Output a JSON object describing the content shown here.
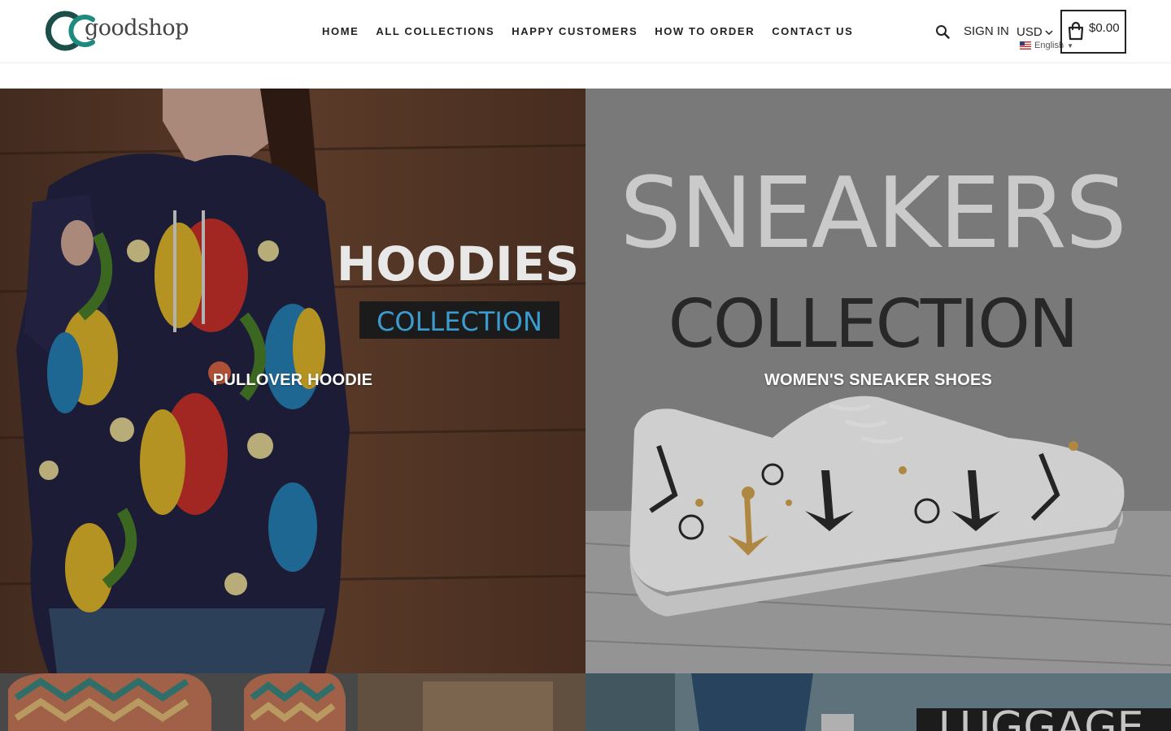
{
  "header": {
    "logo_text": "goodshop",
    "nav": [
      {
        "label": "HOME"
      },
      {
        "label": "ALL COLLECTIONS"
      },
      {
        "label": "HAPPY CUSTOMERS"
      },
      {
        "label": "HOW TO ORDER"
      },
      {
        "label": "CONTACT US"
      }
    ],
    "sign_in": "SIGN IN",
    "currency": "USD",
    "language": "English",
    "cart_total": "$0.00"
  },
  "collections": [
    {
      "title": "PULLOVER HOODIE",
      "banner_heading": "HOODIES",
      "banner_sub": "COLLECTION"
    },
    {
      "title": "WOMEN'S SNEAKER SHOES",
      "banner_heading": "SNEAKERS",
      "banner_sub": "COLLECTION"
    },
    {
      "title": ""
    },
    {
      "title": "",
      "banner_heading": "LUGGAGE"
    }
  ],
  "colors": {
    "brand_teal": "#1f8a80",
    "brand_dark": "#1d4f4a",
    "accent_blue": "#3a9cd0"
  }
}
